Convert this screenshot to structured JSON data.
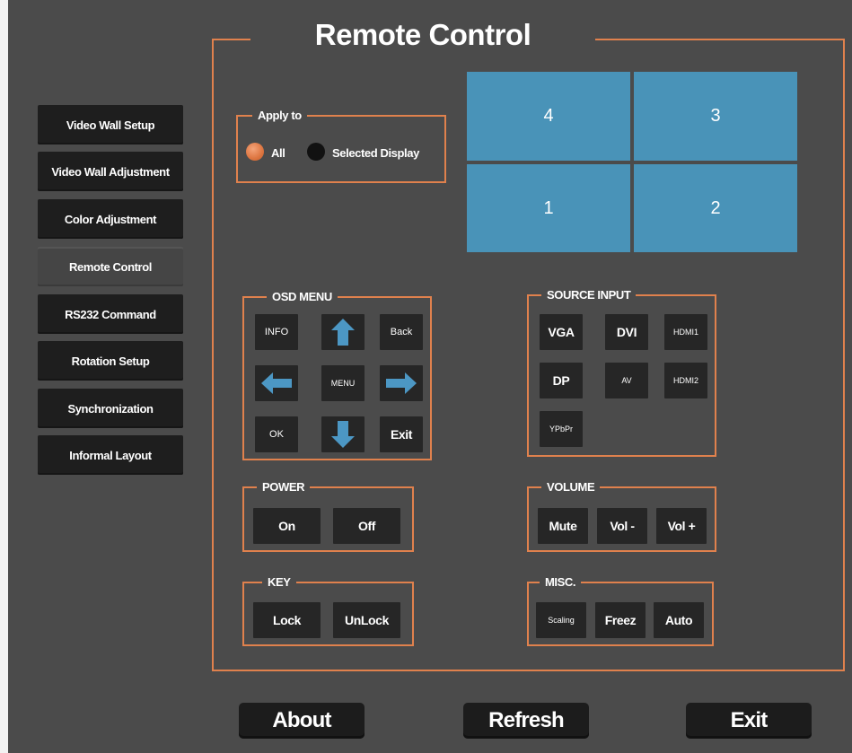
{
  "title": "Remote Control",
  "sidebar": {
    "items": [
      {
        "label": "Video Wall Setup"
      },
      {
        "label": "Video Wall Adjustment"
      },
      {
        "label": "Color Adjustment"
      },
      {
        "label": "Remote Control",
        "active": true
      },
      {
        "label": "RS232 Command"
      },
      {
        "label": "Rotation Setup"
      },
      {
        "label": "Synchronization"
      },
      {
        "label": "Informal Layout"
      }
    ]
  },
  "apply_to": {
    "label": "Apply to",
    "options": [
      {
        "label": "All",
        "selected": true
      },
      {
        "label": "Selected Display",
        "selected": false
      }
    ]
  },
  "displays": [
    "4",
    "3",
    "1",
    "2"
  ],
  "osd_menu": {
    "label": "OSD MENU",
    "info": "INFO",
    "back": "Back",
    "menu": "MENU",
    "ok": "OK",
    "exit": "Exit",
    "icons": [
      "arrow-up-icon",
      "arrow-left-icon",
      "arrow-right-icon",
      "arrow-down-icon"
    ]
  },
  "source_input": {
    "label": "SOURCE INPUT",
    "vga": "VGA",
    "dvi": "DVI",
    "hdmi1": "HDMI1",
    "dp": "DP",
    "av": "AV",
    "hdmi2": "HDMI2",
    "ypbpr": "YPbPr"
  },
  "power": {
    "label": "POWER",
    "on": "On",
    "off": "Off"
  },
  "volume": {
    "label": "VOLUME",
    "mute": "Mute",
    "down": "Vol -",
    "up": "Vol +"
  },
  "key": {
    "label": "KEY",
    "lock": "Lock",
    "unlock": "UnLock"
  },
  "misc": {
    "label": "MISC.",
    "scaling": "Scaling",
    "freez": "Freez",
    "auto": "Auto"
  },
  "footer": {
    "about": "About",
    "refresh": "Refresh",
    "exit": "Exit"
  },
  "colors": {
    "accent": "#e0814d",
    "tile": "#4993b8",
    "arrow": "#4c97c4",
    "background": "#4b4b4b"
  }
}
